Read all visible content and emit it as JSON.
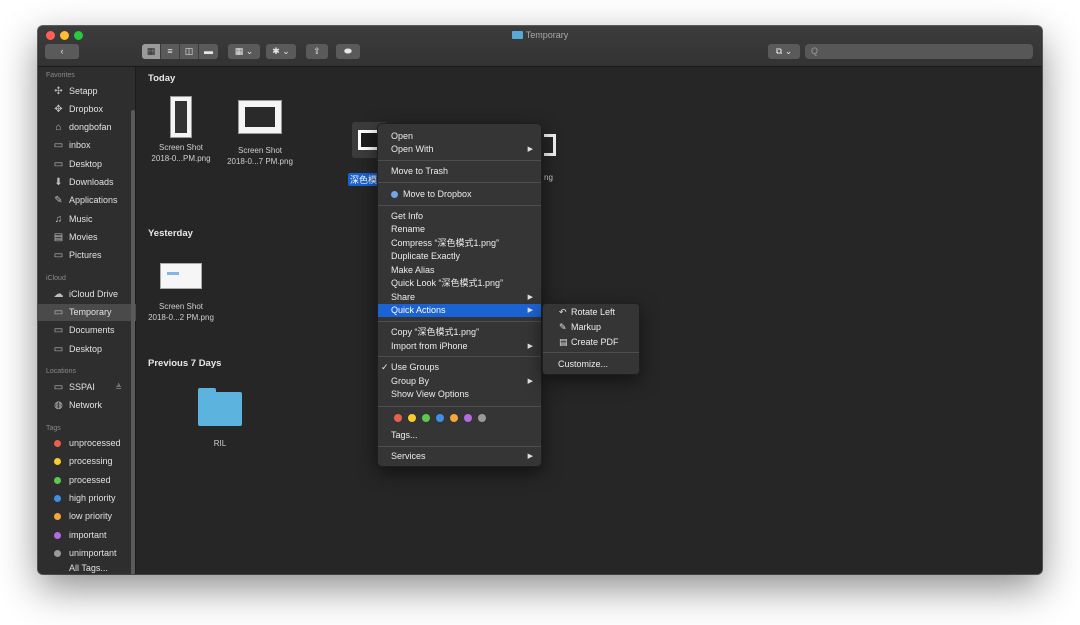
{
  "window": {
    "title": "Temporary"
  },
  "toolbar": {
    "back_label": "‹",
    "view_icons": [
      "▦",
      "≡",
      "◫",
      "▬"
    ],
    "group_label": "▦ ⌄",
    "action_label": "✱ ⌄",
    "share_label": "⇪",
    "tag_label": "⬬",
    "dropbox_label": "⧉ ⌄",
    "search_placeholder": "Q"
  },
  "sidebar": {
    "sections": [
      {
        "title": "Favorites",
        "items": [
          {
            "label": "Setapp",
            "icon": "✣"
          },
          {
            "label": "Dropbox",
            "icon": "✥"
          },
          {
            "label": "dongbofan",
            "icon": "⌂"
          },
          {
            "label": "inbox",
            "icon": "▭"
          },
          {
            "label": "Desktop",
            "icon": "▭"
          },
          {
            "label": "Downloads",
            "icon": "⬇"
          },
          {
            "label": "Applications",
            "icon": "✎"
          },
          {
            "label": "Music",
            "icon": "♫"
          },
          {
            "label": "Movies",
            "icon": "▤"
          },
          {
            "label": "Pictures",
            "icon": "▭"
          }
        ]
      },
      {
        "title": "iCloud",
        "items": [
          {
            "label": "iCloud Drive",
            "icon": "☁"
          },
          {
            "label": "Temporary",
            "icon": "▭",
            "selected": true
          },
          {
            "label": "Documents",
            "icon": "▭"
          },
          {
            "label": "Desktop",
            "icon": "▭"
          }
        ]
      },
      {
        "title": "Locations",
        "items": [
          {
            "label": "SSPAI",
            "icon": "▭",
            "eject": "≜"
          },
          {
            "label": "Network",
            "icon": "◍"
          }
        ]
      },
      {
        "title": "Tags",
        "items": [
          {
            "label": "unprocessed",
            "color": "#e8604c"
          },
          {
            "label": "processing",
            "color": "#f5cd2f"
          },
          {
            "label": "processed",
            "color": "#5fc74e"
          },
          {
            "label": "high priority",
            "color": "#3e8fe8"
          },
          {
            "label": "low priority",
            "color": "#f5a73a"
          },
          {
            "label": "important",
            "color": "#b36ae2"
          },
          {
            "label": "unimportant",
            "color": "#9a9a9a"
          }
        ]
      }
    ],
    "cut_item": "All Tags..."
  },
  "groups": [
    {
      "title": "Today"
    },
    {
      "title": "Yesterday"
    },
    {
      "title": "Previous 7 Days"
    }
  ],
  "files": {
    "today": [
      {
        "name_line1": "Screen Shot",
        "name_line2": "2018-0...PM.png"
      },
      {
        "name_line1": "Screen Shot",
        "name_line2": "2018-0...7 PM.png"
      },
      {
        "name_line1": "深色模",
        "name_line2": ""
      },
      {
        "name_line1": "ng",
        "name_line2": ""
      }
    ],
    "yesterday": [
      {
        "name_line1": "Screen Shot",
        "name_line2": "2018-0...2 PM.png"
      }
    ],
    "previous": [
      {
        "name_line1": "RIL",
        "name_line2": ""
      }
    ]
  },
  "context_menu": {
    "items": [
      {
        "label": "Open"
      },
      {
        "label": "Open With",
        "submenu": true
      },
      {
        "label": "Move to Trash"
      },
      {
        "label": "Move to Dropbox",
        "dropbox": true
      },
      {
        "label": "Get Info"
      },
      {
        "label": "Rename"
      },
      {
        "label": "Compress “深色模式1.png”"
      },
      {
        "label": "Duplicate Exactly"
      },
      {
        "label": "Make Alias"
      },
      {
        "label": "Quick Look “深色模式1.png”"
      },
      {
        "label": "Share",
        "submenu": true
      },
      {
        "label": "Quick Actions",
        "submenu": true,
        "highlight": true
      },
      {
        "label": "Copy “深色模式1.png”"
      },
      {
        "label": "Import from iPhone",
        "submenu": true
      },
      {
        "label": "Use Groups",
        "checked": true
      },
      {
        "label": "Group By",
        "submenu": true
      },
      {
        "label": "Show View Options"
      },
      {
        "label": "Tags..."
      },
      {
        "label": "Services",
        "submenu": true
      }
    ],
    "tag_colors": [
      "#e8604c",
      "#f5cd2f",
      "#5fc74e",
      "#3e8fe8",
      "#f5a73a",
      "#b36ae2",
      "#9a9a9a"
    ],
    "arrow_glyph": "▶",
    "check_glyph": "✓"
  },
  "quick_actions_submenu": {
    "items": [
      {
        "label": "Rotate Left",
        "icon": "↶"
      },
      {
        "label": "Markup",
        "icon": "✎"
      },
      {
        "label": "Create PDF",
        "icon": "▤"
      },
      {
        "label": "Customize..."
      }
    ]
  }
}
